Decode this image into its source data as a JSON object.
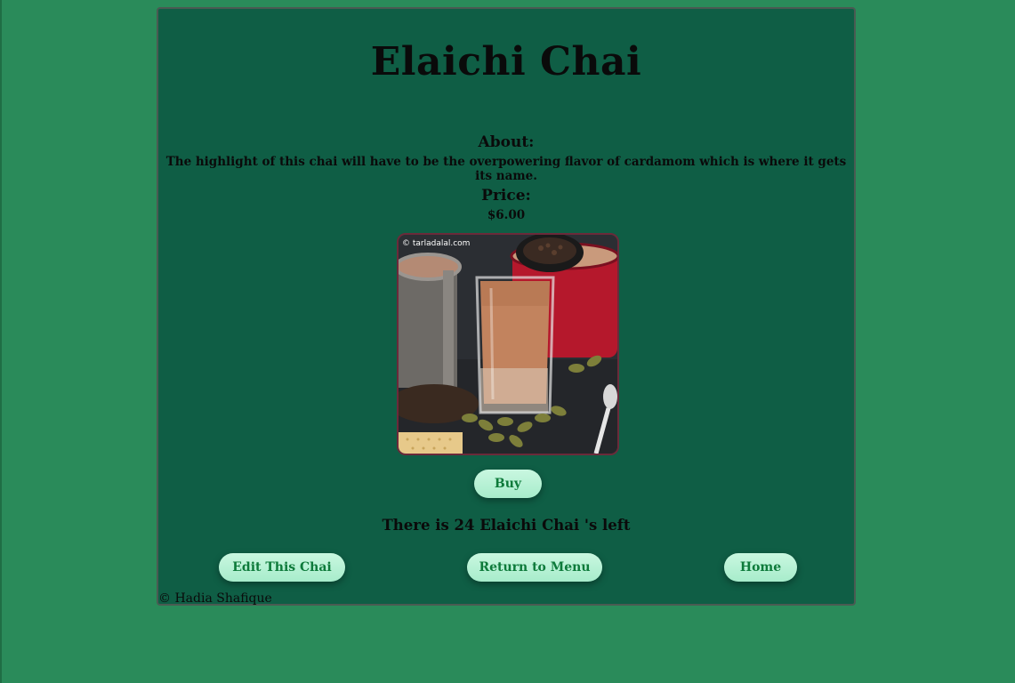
{
  "page": {
    "title": "Elaichi Chai",
    "about_label": "About:",
    "about_text": "The highlight of this chai will have to be the overpowering flavor of cardamom which is where it gets its name.",
    "price_label": "Price:",
    "price_value": "$6.00",
    "image_watermark": "© tarladalal.com",
    "buy_label": "Buy",
    "stock_text": "There is 24 Elaichi Chai 's left"
  },
  "actions": {
    "edit_label": "Edit This Chai",
    "menu_label": "Return to Menu",
    "home_label": "Home"
  },
  "footer": {
    "copyright": "© Hadia Shafique"
  },
  "colors": {
    "page_background": "#2a8b5a",
    "card_background": "#0f5e45",
    "button_background": "#b8f2d6",
    "button_text": "#0d7a3a"
  }
}
